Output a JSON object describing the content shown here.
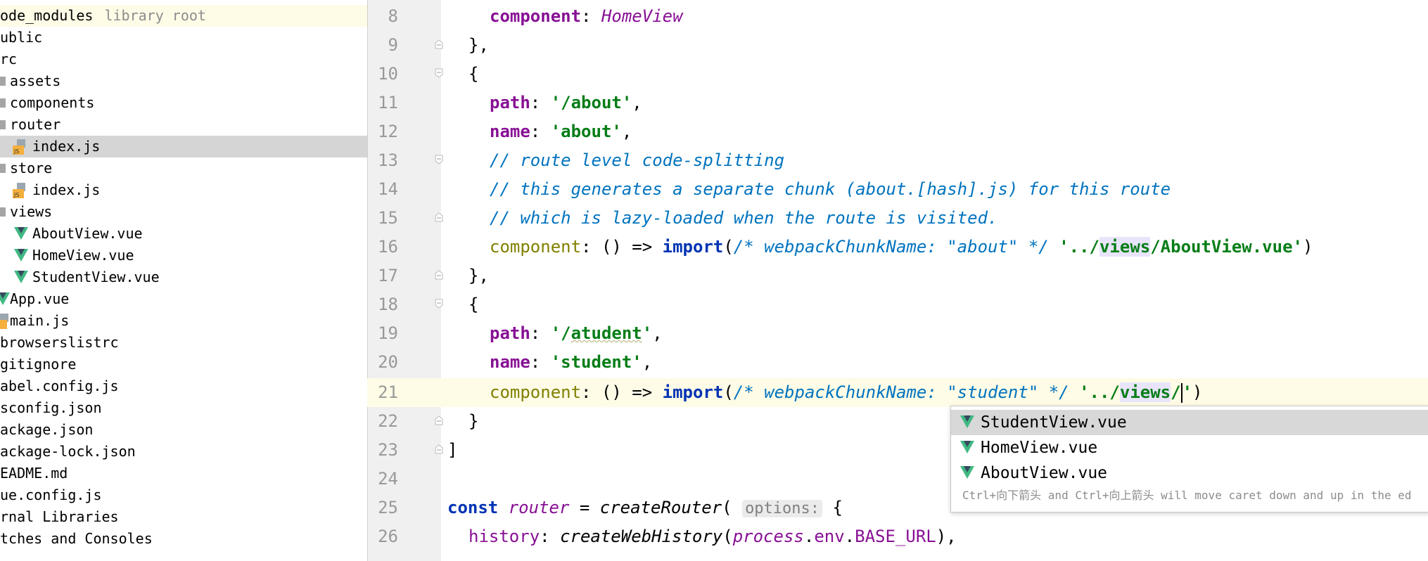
{
  "sidebar": {
    "rows": [
      {
        "label": "ode_modules",
        "hint": "library root"
      },
      {
        "label": "ublic"
      },
      {
        "label": "rc"
      },
      {
        "label": "assets"
      },
      {
        "label": "components"
      },
      {
        "label": "router"
      },
      {
        "label": "index.js"
      },
      {
        "label": "store"
      },
      {
        "label": "index.js"
      },
      {
        "label": "views"
      },
      {
        "label": "AboutView.vue"
      },
      {
        "label": "HomeView.vue"
      },
      {
        "label": "StudentView.vue"
      },
      {
        "label": "App.vue"
      },
      {
        "label": "main.js"
      },
      {
        "label": "browserslistrc"
      },
      {
        "label": "gitignore"
      },
      {
        "label": "abel.config.js"
      },
      {
        "label": "sconfig.json"
      },
      {
        "label": "ackage.json"
      },
      {
        "label": "ackage-lock.json"
      },
      {
        "label": "EADME.md"
      },
      {
        "label": "ue.config.js"
      },
      {
        "label": "rnal Libraries"
      },
      {
        "label": "tches and Consoles"
      }
    ]
  },
  "editor": {
    "line_numbers": [
      "8",
      "9",
      "10",
      "11",
      "12",
      "13",
      "14",
      "15",
      "16",
      "17",
      "18",
      "19",
      "20",
      "21",
      "22",
      "23",
      "24",
      "25",
      "26"
    ],
    "current_line": "21",
    "code": {
      "l8_key": "component",
      "l8_val": "HomeView",
      "l9": "},",
      "l10": "{",
      "l11_key": "path",
      "l11_val": "'/about'",
      "l12_key": "name",
      "l12_val": "'about'",
      "l13": "// route level code-splitting",
      "l14": "// this generates a separate chunk (about.[hash].js) for this route",
      "l15": "// which is lazy-loaded when the route is visited.",
      "l16_key": "component",
      "l16_arrow": ": () => ",
      "l16_import": "import",
      "l16_cmt": "/* webpackChunkName: \"about\" */",
      "l16_str_a": "'../",
      "l16_str_hl": "views",
      "l16_str_b": "/AboutView.vue'",
      "l17": "},",
      "l18": "{",
      "l19_key": "path",
      "l19_val_a": "'/",
      "l19_val_squig": "atudent",
      "l19_val_b": "'",
      "l20_key": "name",
      "l20_val": "'student'",
      "l21_key": "component",
      "l21_arrow": ": () => ",
      "l21_import": "import",
      "l21_cmt": "/* webpackChunkName: \"student\" */",
      "l21_str_a": "'../",
      "l21_str_hl": "views",
      "l21_str_b": "/",
      "l21_str_c": "'",
      "l22": "}",
      "l23": "]",
      "l25_const": "const",
      "l25_var": "router",
      "l25_fn": "createRouter",
      "l25_hint": "options:",
      "l25_brace": "{",
      "l26_key": "history",
      "l26_fn": "createWebHistory",
      "l26_proc": "process",
      "l26_env": "env",
      "l26_base": "BASE_URL"
    }
  },
  "completion": {
    "items": [
      "StudentView.vue",
      "HomeView.vue",
      "AboutView.vue"
    ],
    "selected": "StudentView.vue",
    "hint": "Ctrl+向下箭头 and Ctrl+向上箭头 will move caret down and up in the ed"
  },
  "colors": {
    "vue_green": "#41b883",
    "vue_dark": "#35495e",
    "keyword": "#0033b3",
    "string": "#067d17",
    "property": "#871094"
  }
}
